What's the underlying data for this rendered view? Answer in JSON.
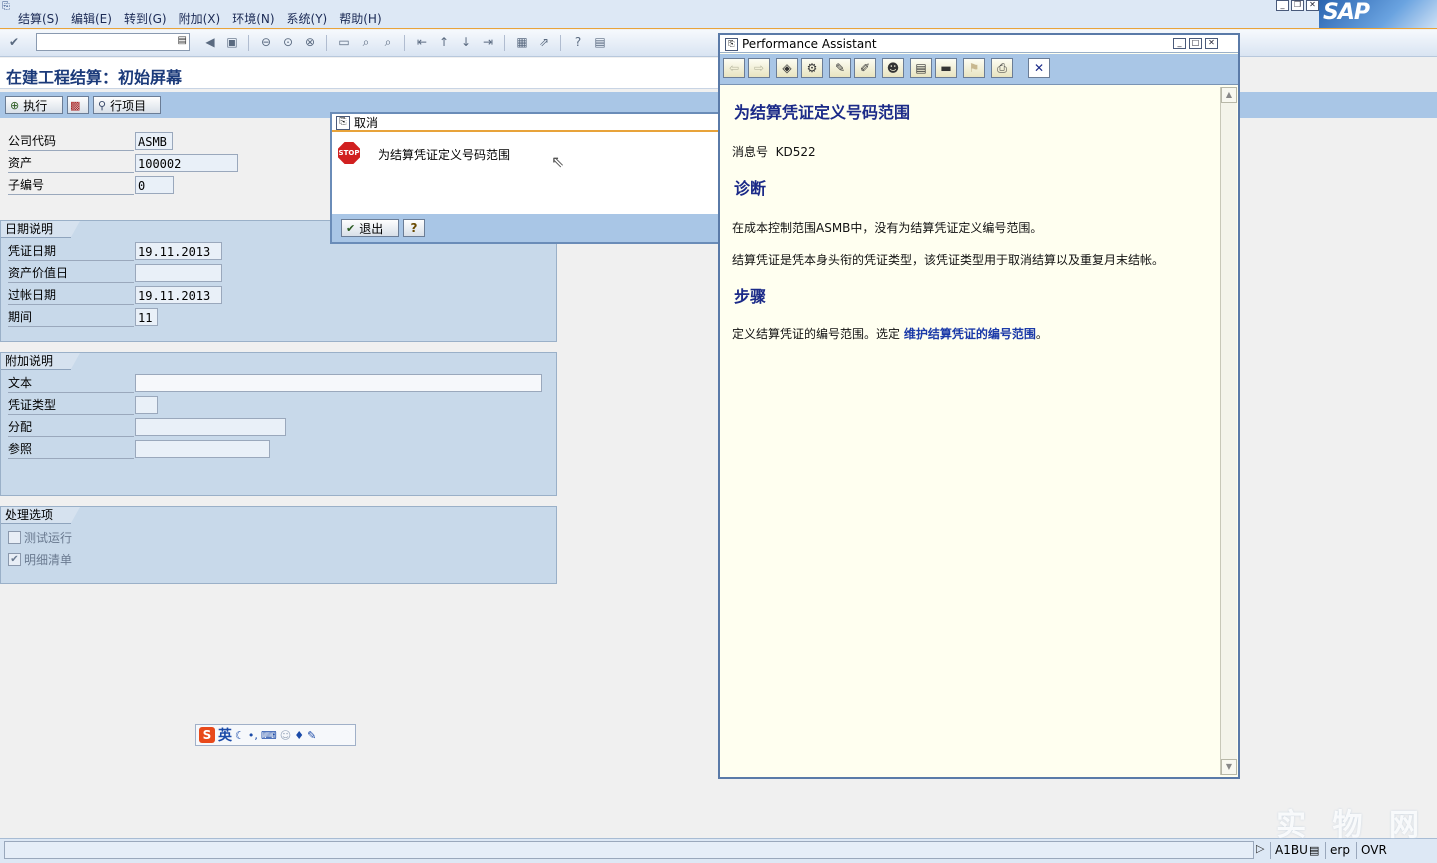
{
  "menu": {
    "items": [
      "结算(S)",
      "编辑(E)",
      "转到(G)",
      "附加(X)",
      "环境(N)",
      "系统(Y)",
      "帮助(H)"
    ]
  },
  "brand": "SAP",
  "page": {
    "title": "在建工程结算：初始屏幕"
  },
  "app_toolbar": {
    "execute": "执行",
    "line_items": "行项目"
  },
  "fields": {
    "company_code": {
      "label": "公司代码",
      "value": "ASMB"
    },
    "asset": {
      "label": "资产",
      "value": "100002"
    },
    "sub_number": {
      "label": "子编号",
      "value": "0"
    }
  },
  "date_group": {
    "title": "日期说明",
    "doc_date": {
      "label": "凭证日期",
      "value": "19.11.2013"
    },
    "asset_value_date": {
      "label": "资产价值日",
      "value": ""
    },
    "posting_date": {
      "label": "过帐日期",
      "value": "19.11.2013"
    },
    "period": {
      "label": "期间",
      "value": "11"
    }
  },
  "additional_group": {
    "title": "附加说明",
    "text": {
      "label": "文本",
      "value": ""
    },
    "doc_type": {
      "label": "凭证类型",
      "value": ""
    },
    "assignment": {
      "label": "分配",
      "value": ""
    },
    "reference": {
      "label": "参照",
      "value": ""
    }
  },
  "processing_group": {
    "title": "处理选项",
    "test_run": {
      "label": "测试运行",
      "checked": false
    },
    "detail_list": {
      "label": "明细清单",
      "checked": true
    }
  },
  "dialog": {
    "title": "取消",
    "stop_text": "STOP",
    "message": "为结算凭证定义号码范围",
    "exit": "退出"
  },
  "assistant": {
    "window_title": "Performance Assistant",
    "heading": "为结算凭证定义号码范围",
    "message_no_label": "消息号",
    "message_no": "KD522",
    "diagnosis_heading": "诊断",
    "diagnosis_1": "在成本控制范围ASMB中，没有为结算凭证定义编号范围。",
    "diagnosis_2": "结算凭证是凭本身头衔的凭证类型，该凭证类型用于取消结算以及重复月末结帐。",
    "procedure_heading": "步骤",
    "procedure_prefix": "定义结算凭证的编号范围。选定",
    "procedure_link": "维护结算凭证的编号范围",
    "procedure_suffix": "。"
  },
  "ime": {
    "logo": "S",
    "lang": "英"
  },
  "status": {
    "client": "A1BU",
    "system": "erp",
    "mode": "OVR"
  },
  "watermark": "实 物 网"
}
